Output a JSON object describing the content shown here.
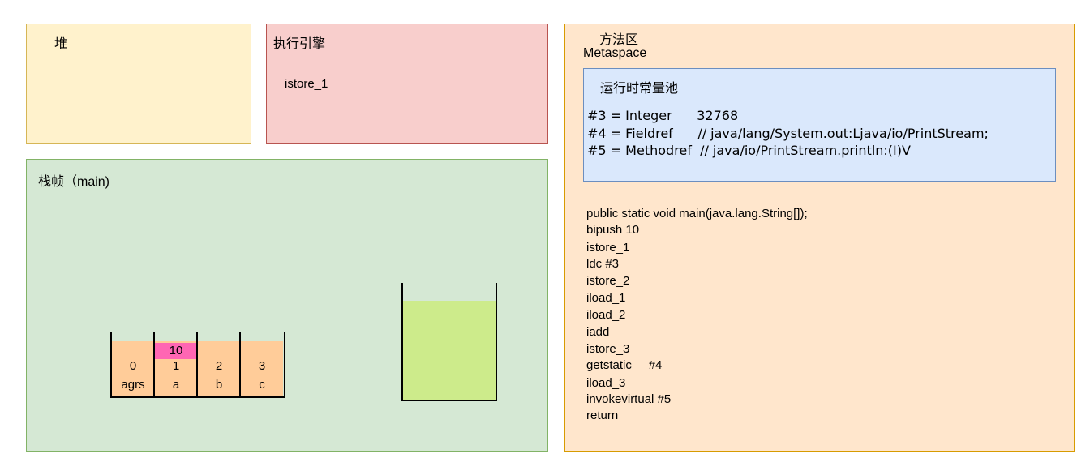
{
  "heap": {
    "title": "堆"
  },
  "engine": {
    "title": "执行引擎",
    "instruction": "istore_1"
  },
  "frame": {
    "title": "栈帧（main)",
    "locals": [
      {
        "index": "0",
        "name": "agrs",
        "value": ""
      },
      {
        "index": "1",
        "name": "a",
        "value": "10"
      },
      {
        "index": "2",
        "name": "b",
        "value": ""
      },
      {
        "index": "3",
        "name": "c",
        "value": ""
      }
    ]
  },
  "method_area": {
    "title": "方法区",
    "subtitle": "Metaspace",
    "constant_pool": {
      "title": "运行时常量池",
      "entries": [
        "#3 = Integer      32768",
        "#4 = Fieldref      // java/lang/System.out:Ljava/io/PrintStream;",
        "#5 = Methodref  // java/io/PrintStream.println:(I)V"
      ]
    },
    "bytecode": [
      "public static void main(java.lang.String[]);",
      "bipush 10",
      "istore_1",
      "ldc #3",
      "istore_2",
      "iload_1",
      "iload_2",
      "iadd",
      "istore_3",
      "getstatic     #4",
      "iload_3",
      "invokevirtual #5",
      "return"
    ]
  },
  "colors": {
    "heap": "#fff2cc",
    "engine": "#f8cecc",
    "frame": "#d5e8d4",
    "method_area": "#ffe6cc",
    "constant_pool": "#dae8fc",
    "local_slot": "#ffcc99",
    "slot_value": "#ff66b3",
    "operand_stack": "#cdeb8b"
  }
}
